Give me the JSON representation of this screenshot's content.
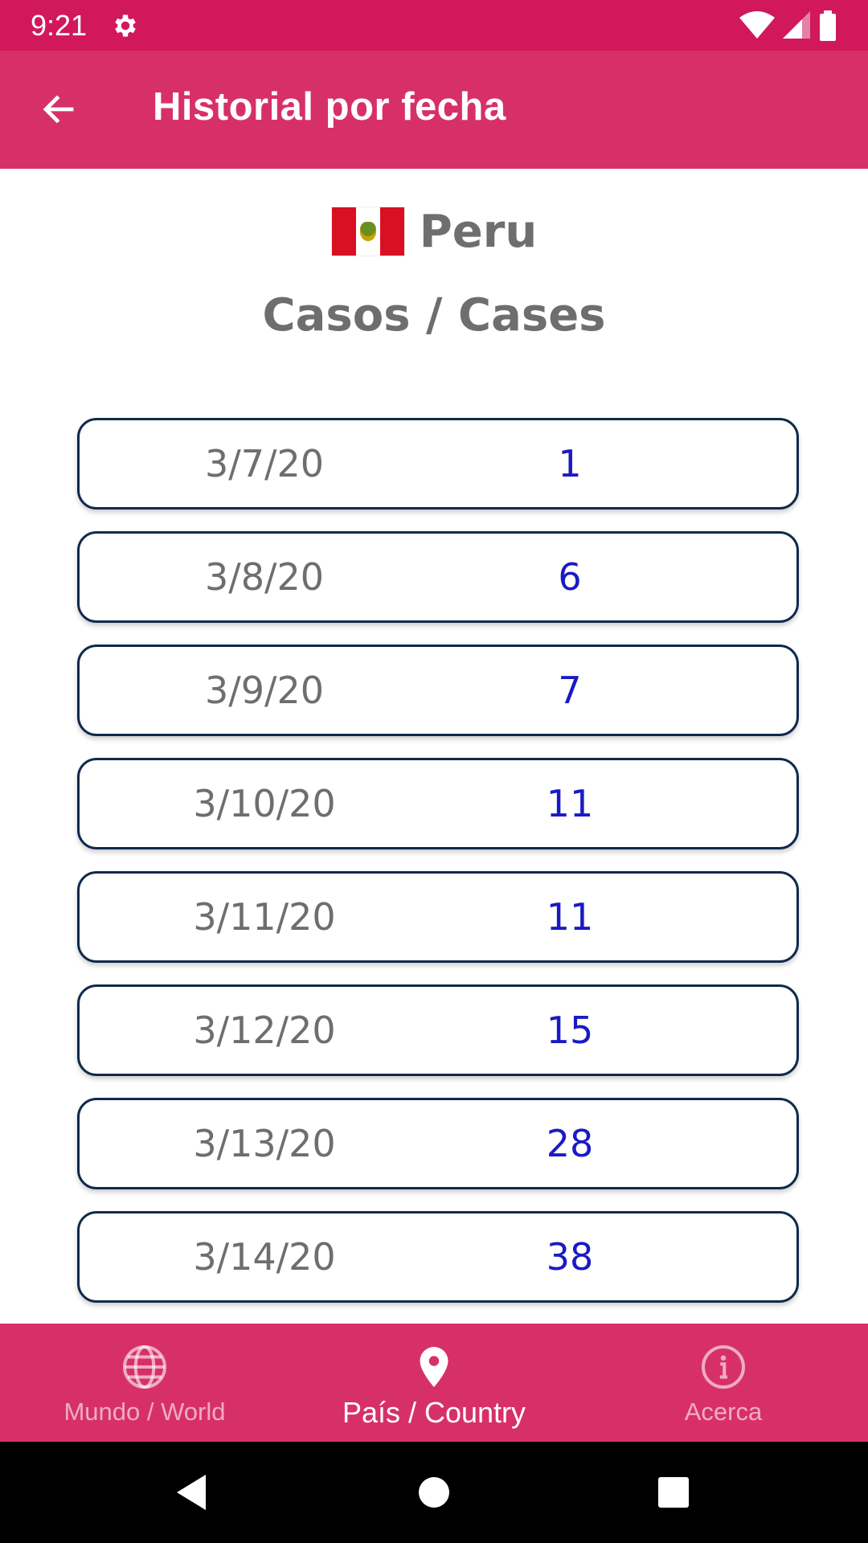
{
  "status_bar": {
    "time": "9:21"
  },
  "app_bar": {
    "title": "Historial por fecha"
  },
  "header": {
    "country": "Peru",
    "section_title": "Casos / Cases"
  },
  "history": [
    {
      "date": "3/7/20",
      "cases": "1"
    },
    {
      "date": "3/8/20",
      "cases": "6"
    },
    {
      "date": "3/9/20",
      "cases": "7"
    },
    {
      "date": "3/10/20",
      "cases": "11"
    },
    {
      "date": "3/11/20",
      "cases": "11"
    },
    {
      "date": "3/12/20",
      "cases": "15"
    },
    {
      "date": "3/13/20",
      "cases": "28"
    },
    {
      "date": "3/14/20",
      "cases": "38"
    }
  ],
  "bottom_nav": {
    "items": [
      {
        "label": "Mundo / World",
        "icon": "globe-icon",
        "active": false
      },
      {
        "label": "País / Country",
        "icon": "location-pin-icon",
        "active": true
      },
      {
        "label": "Acerca",
        "icon": "info-icon",
        "active": false
      }
    ]
  },
  "colors": {
    "status_bar": "#D1185A",
    "app_bar": "#D73069",
    "row_border": "#102A4C",
    "value_text": "#1A1AC4",
    "gray_text": "#6E6E6E"
  }
}
